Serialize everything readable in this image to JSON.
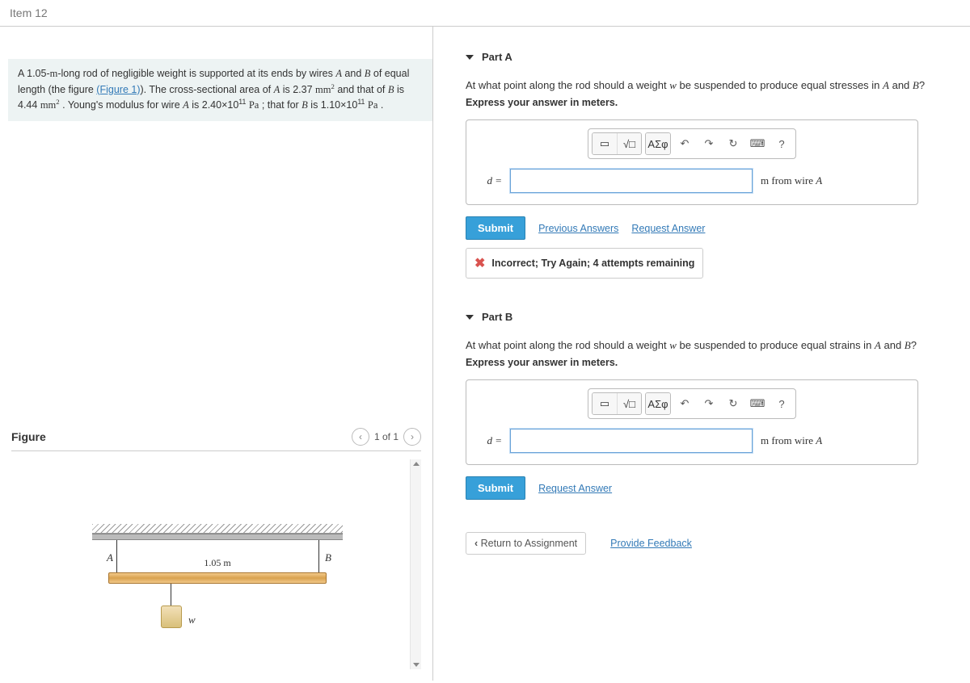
{
  "header": {
    "title": "Item 12"
  },
  "problem": {
    "text_1": "A 1.05-",
    "len_unit": "m",
    "text_2": "-long rod of negligible weight is supported at its ends by wires ",
    "A": "A",
    "text_3": " and ",
    "B": "B",
    "text_4": " of equal length (the figure ",
    "fig_link": "(Figure 1)",
    "text_5": "). The cross-sectional area of ",
    "text_6": " is 2.37 ",
    "mm2": "mm",
    "text_7": " and that of ",
    "text_8": " is 4.44 ",
    "text_9": " . Young's modulus for wire ",
    "text_10": " is 2.40×10",
    "exp11": "11",
    "Pa": "Pa",
    "text_11": " ; that for ",
    "text_12": " is 1.10×10",
    "text_13": " ."
  },
  "figure": {
    "title": "Figure",
    "pager": "1 of 1",
    "labelA": "A",
    "labelB": "B",
    "length": "1.05 m",
    "w": "w"
  },
  "partA": {
    "title": "Part A",
    "question_1": "At what point along the rod should a weight ",
    "w": "w",
    "question_2": " be suspended to produce equal stresses in ",
    "A": "A",
    "and": " and ",
    "B": "B",
    "qmark": "?",
    "instruct": "Express your answer in meters.",
    "greek": "ΑΣφ",
    "dvar": "d =",
    "unit_1": "m",
    "unit_2": " from wire ",
    "unit_3": "A",
    "submit": "Submit",
    "prev": "Previous Answers",
    "req": "Request Answer",
    "feedback": "Incorrect; Try Again; 4 attempts remaining"
  },
  "partB": {
    "title": "Part B",
    "question_1": "At what point along the rod should a weight ",
    "w": "w",
    "question_2": " be suspended to produce equal strains in ",
    "A": "A",
    "and": " and ",
    "B": "B",
    "qmark": "?",
    "instruct": "Express your answer in meters.",
    "greek": "ΑΣφ",
    "dvar": "d =",
    "unit_1": "m",
    "unit_2": " from wire ",
    "unit_3": "A",
    "submit": "Submit",
    "req": "Request Answer"
  },
  "footer": {
    "return": "Return to Assignment",
    "feedback": "Provide Feedback"
  },
  "toolbar": {
    "help": "?"
  }
}
